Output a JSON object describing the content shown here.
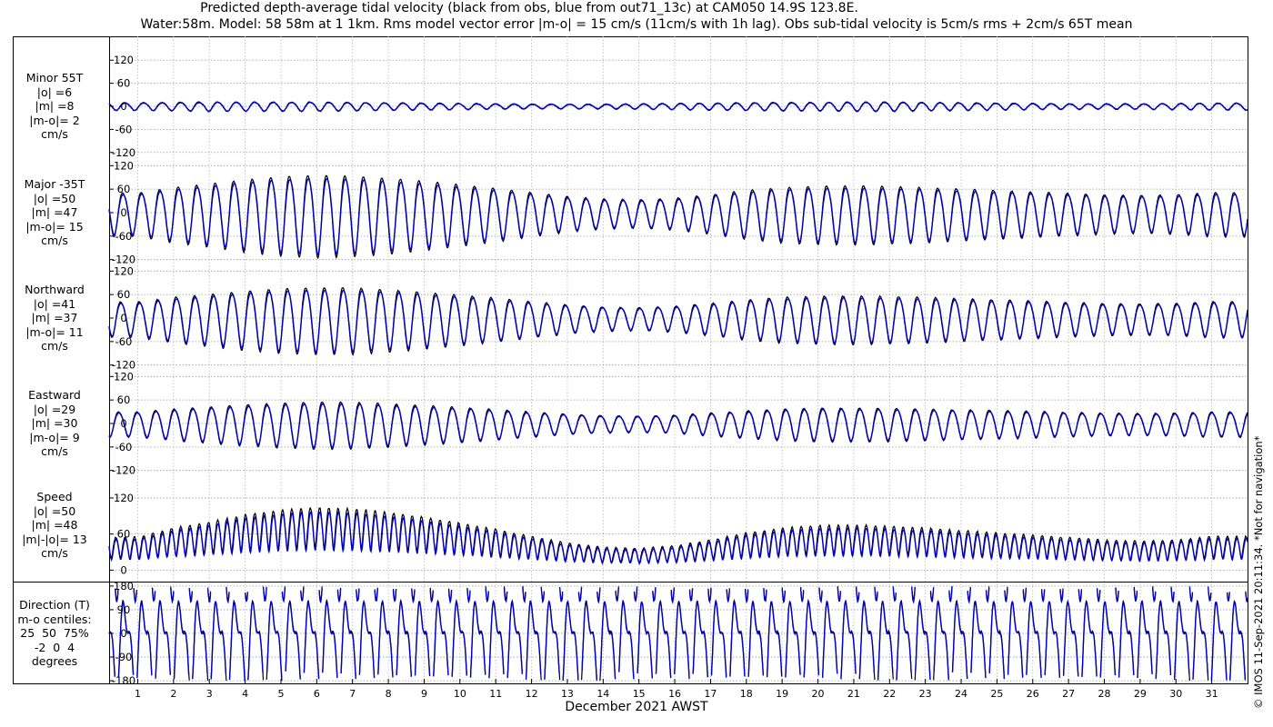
{
  "title_line1": "Predicted depth-average tidal velocity (black from obs, blue from out71_13c) at CAM050 14.9S 123.8E.",
  "title_line2": "Water:58m. Model: 58 58m at 1 1km. Rms model vector error |m-o| = 15 cm/s (11cm/s with 1h lag). Obs sub-tidal velocity is 5cm/s rms + 2cm/s 65T mean",
  "x_axis_label": "December 2021 AWST",
  "credit": "© IMOS 11-Sep-2021 20:11:34. *Not for navigation*",
  "colors": {
    "observed": "#000000",
    "model": "#0000cc"
  },
  "x_ticks": [
    "1",
    "2",
    "3",
    "4",
    "5",
    "6",
    "7",
    "8",
    "9",
    "10",
    "11",
    "12",
    "13",
    "14",
    "15",
    "16",
    "17",
    "18",
    "19",
    "20",
    "21",
    "22",
    "23",
    "24",
    "25",
    "26",
    "27",
    "28",
    "29",
    "30",
    "31"
  ],
  "panels": [
    {
      "label_lines": [
        "Minor 55T",
        "|o| =6",
        "|m| =8",
        "|m-o|= 2",
        "cm/s"
      ],
      "y_ticks": [
        "120",
        "60",
        "0",
        "-60",
        "-120"
      ]
    },
    {
      "label_lines": [
        "Major -35T",
        "|o| =50",
        "|m| =47",
        "|m-o|= 15",
        "cm/s"
      ],
      "y_ticks": [
        "120",
        "60",
        "0",
        "-60",
        "-120"
      ]
    },
    {
      "label_lines": [
        "Northward",
        "|o| =41",
        "|m| =37",
        "|m-o|= 11",
        "cm/s"
      ],
      "y_ticks": [
        "120",
        "60",
        "0",
        "-60",
        "-120"
      ]
    },
    {
      "label_lines": [
        "Eastward",
        "|o| =29",
        "|m| =30",
        "|m-o|= 9",
        "cm/s"
      ],
      "y_ticks": [
        "120",
        "60",
        "0",
        "-60",
        "-120"
      ]
    },
    {
      "label_lines": [
        "Speed",
        "|o| =50",
        "|m| =48",
        "|m|-|o|= 13",
        "cm/s"
      ],
      "y_ticks": [
        "120",
        "60",
        "0"
      ]
    },
    {
      "label_lines": [
        "Direction (T)",
        "m-o centiles:",
        "25  50  75%",
        "-2  0  4",
        "degrees"
      ],
      "y_ticks": [
        "180",
        "90",
        "0",
        "-90",
        "-180"
      ]
    }
  ],
  "chart_data": {
    "type": "line",
    "x_unit": "day of December 2021 (AWST)",
    "xlim": [
      0.2,
      32
    ],
    "series": [
      {
        "name": "obs",
        "color": "#000000"
      },
      {
        "name": "out71_13c",
        "color": "#0000cc"
      }
    ],
    "panels": [
      {
        "name": "Minor 55T",
        "ylim": [
          -130,
          130
        ],
        "unit": "cm/s",
        "obs_rms": 6,
        "model_rms": 8,
        "rms_diff": 2,
        "amplitude_cm_s": [
          10,
          11,
          12,
          12,
          12,
          12,
          11,
          10,
          9,
          8,
          7,
          6,
          6,
          6,
          7,
          8,
          9,
          10,
          11,
          11,
          12,
          12,
          11,
          10,
          9,
          8,
          7,
          7,
          7,
          8,
          9
        ]
      },
      {
        "name": "Major -35T",
        "ylim": [
          -130,
          130
        ],
        "unit": "cm/s",
        "obs_rms": 50,
        "model_rms": 47,
        "rms_diff": 15,
        "amplitude_cm_s": [
          55,
          70,
          80,
          92,
          100,
          104,
          102,
          96,
          88,
          78,
          68,
          56,
          45,
          38,
          36,
          40,
          50,
          62,
          70,
          74,
          75,
          73,
          70,
          66,
          62,
          58,
          54,
          50,
          48,
          50,
          56
        ]
      },
      {
        "name": "Northward",
        "ylim": [
          -130,
          130
        ],
        "unit": "cm/s",
        "obs_rms": 41,
        "model_rms": 37,
        "rms_diff": 11,
        "amplitude_cm_s": [
          45,
          58,
          66,
          75,
          82,
          85,
          84,
          79,
          72,
          64,
          56,
          46,
          37,
          31,
          29,
          33,
          41,
          51,
          58,
          61,
          62,
          60,
          58,
          54,
          51,
          48,
          44,
          41,
          40,
          41,
          46
        ]
      },
      {
        "name": "Eastward",
        "ylim": [
          -130,
          130
        ],
        "unit": "cm/s",
        "obs_rms": 29,
        "model_rms": 30,
        "rms_diff": 9,
        "amplitude_cm_s": [
          32,
          40,
          46,
          52,
          57,
          60,
          59,
          55,
          50,
          45,
          39,
          32,
          26,
          22,
          21,
          23,
          29,
          35,
          40,
          43,
          43,
          42,
          40,
          38,
          36,
          34,
          31,
          29,
          28,
          29,
          32
        ]
      },
      {
        "name": "Speed",
        "ylim": [
          -10,
          135
        ],
        "unit": "cm/s",
        "obs_rms": 50,
        "model_rms": 48,
        "rms_diff": 13,
        "peak_cm_s": [
          55,
          70,
          80,
          92,
          100,
          104,
          102,
          96,
          88,
          78,
          68,
          56,
          45,
          38,
          36,
          40,
          50,
          62,
          70,
          74,
          75,
          73,
          70,
          66,
          62,
          58,
          54,
          50,
          48,
          50,
          56
        ]
      },
      {
        "name": "Direction (T)",
        "ylim": [
          -190,
          190
        ],
        "unit": "degrees",
        "m_minus_o_centiles": {
          "25": -2,
          "50": 0,
          "75": 4
        }
      }
    ]
  }
}
